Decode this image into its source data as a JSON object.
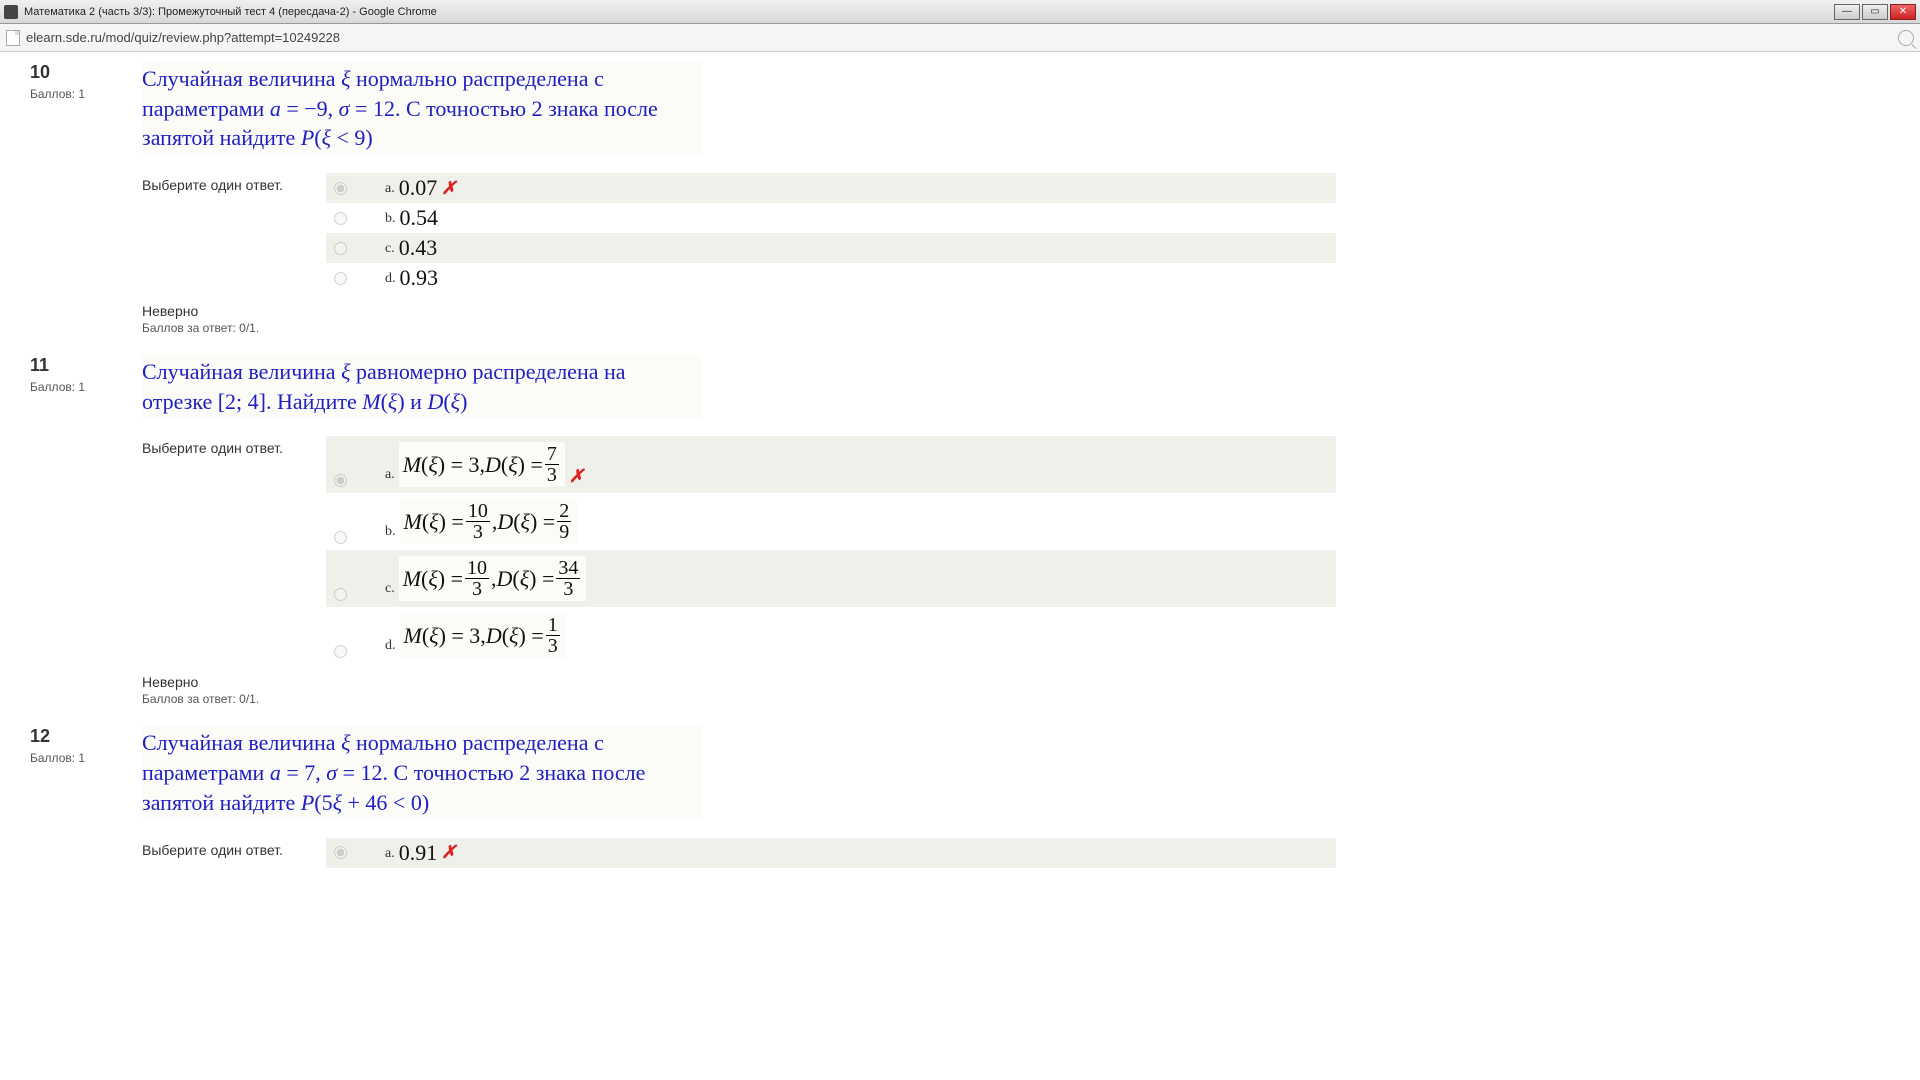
{
  "window": {
    "title": "Математика 2 (часть 3/3): Промежуточный тест 4 (пересдача-2) - Google Chrome",
    "url": "elearn.sde.ru/mod/quiz/review.php?attempt=10249228"
  },
  "questions": [
    {
      "number": "10",
      "score_label": "Баллов: 1",
      "text_html": "Случайная величина <i>ξ</i> нормально распределена с параметрами <i>a</i> = −9, <i>σ</i> = 12. С точностью 2 знака после запятой найдите <i>P</i>(<i>ξ</i> &lt; 9)",
      "choose": "Выберите один ответ.",
      "type": "simple",
      "options": [
        {
          "label": "a.",
          "value": "0.07",
          "selected": true,
          "wrong": true
        },
        {
          "label": "b.",
          "value": "0.54",
          "selected": false,
          "wrong": false
        },
        {
          "label": "c.",
          "value": "0.43",
          "selected": false,
          "wrong": false
        },
        {
          "label": "d.",
          "value": "0.93",
          "selected": false,
          "wrong": false
        }
      ],
      "status": "Неверно",
      "points": "Баллов за ответ: 0/1."
    },
    {
      "number": "11",
      "score_label": "Баллов: 1",
      "text_html": "Случайная величина <i>ξ</i> равномерно распределена на отрезке [2; 4]. Найдите <i>M</i>(<i>ξ</i>) и <i>D</i>(<i>ξ</i>)",
      "choose": "Выберите один ответ.",
      "type": "formula",
      "options": [
        {
          "label": "a.",
          "m": "3",
          "d_num": "7",
          "d_den": "3",
          "m_frac": false,
          "selected": true,
          "wrong": true
        },
        {
          "label": "b.",
          "m_num": "10",
          "m_den": "3",
          "d_num": "2",
          "d_den": "9",
          "m_frac": true,
          "selected": false,
          "wrong": false
        },
        {
          "label": "c.",
          "m_num": "10",
          "m_den": "3",
          "d_num": "34",
          "d_den": "3",
          "m_frac": true,
          "selected": false,
          "wrong": false
        },
        {
          "label": "d.",
          "m": "3",
          "d_num": "1",
          "d_den": "3",
          "m_frac": false,
          "selected": false,
          "wrong": false
        }
      ],
      "status": "Неверно",
      "points": "Баллов за ответ: 0/1."
    },
    {
      "number": "12",
      "score_label": "Баллов: 1",
      "text_html": "Случайная величина <i>ξ</i> нормально распределена с параметрами <i>a</i> = 7, <i>σ</i> = 12. С точностью 2 знака после запятой найдите <i>P</i>(5<i>ξ</i> + 46 &lt; 0)",
      "choose": "Выберите один ответ.",
      "type": "simple",
      "options": [
        {
          "label": "a.",
          "value": "0.91",
          "selected": true,
          "wrong": true
        }
      ],
      "status": "",
      "points": ""
    }
  ]
}
